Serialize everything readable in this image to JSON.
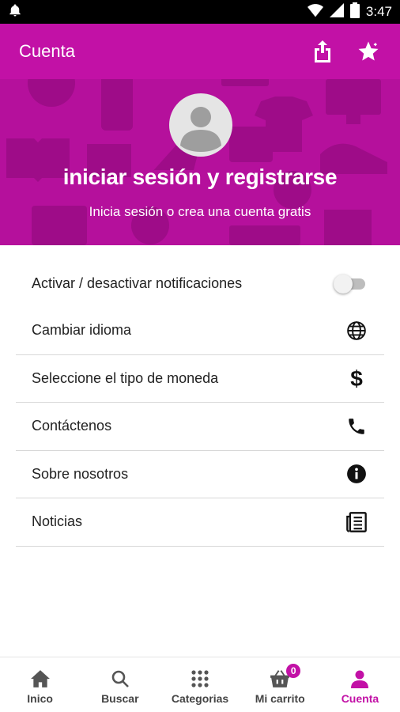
{
  "status_bar": {
    "time": "3:47",
    "icons": [
      "notification-bell-icon",
      "wifi-icon",
      "signal-icon",
      "battery-icon"
    ]
  },
  "app_bar": {
    "title": "Cuenta",
    "actions": [
      "share-icon",
      "rate-star-icon"
    ]
  },
  "hero": {
    "login_title": "iniciar sesión y registrarse",
    "login_subtitle": "Inicia sesión o crea una cuenta gratis"
  },
  "settings": [
    {
      "label": "Activar / desactivar notificaciones",
      "control": "toggle",
      "toggle_on": false
    },
    {
      "label": "Cambiar idioma",
      "icon": "globe-icon"
    },
    {
      "label": "Seleccione el tipo de moneda",
      "icon": "dollar-icon"
    },
    {
      "label": "Contáctenos",
      "icon": "phone-icon"
    },
    {
      "label": "Sobre nosotros",
      "icon": "info-icon"
    },
    {
      "label": "Noticias",
      "icon": "newspaper-icon"
    }
  ],
  "bottom_nav": {
    "tabs": [
      {
        "label": "Inico",
        "icon": "home-icon"
      },
      {
        "label": "Buscar",
        "icon": "search-icon"
      },
      {
        "label": "Categorias",
        "icon": "grid-icon"
      },
      {
        "label": "Mi carrito",
        "icon": "cart-icon",
        "badge": "0"
      },
      {
        "label": "Cuenta",
        "icon": "person-icon",
        "active": true
      }
    ]
  },
  "colors": {
    "primary": "#c211a6",
    "hero_bg": "#b5109c",
    "status_bar": "#000000"
  }
}
